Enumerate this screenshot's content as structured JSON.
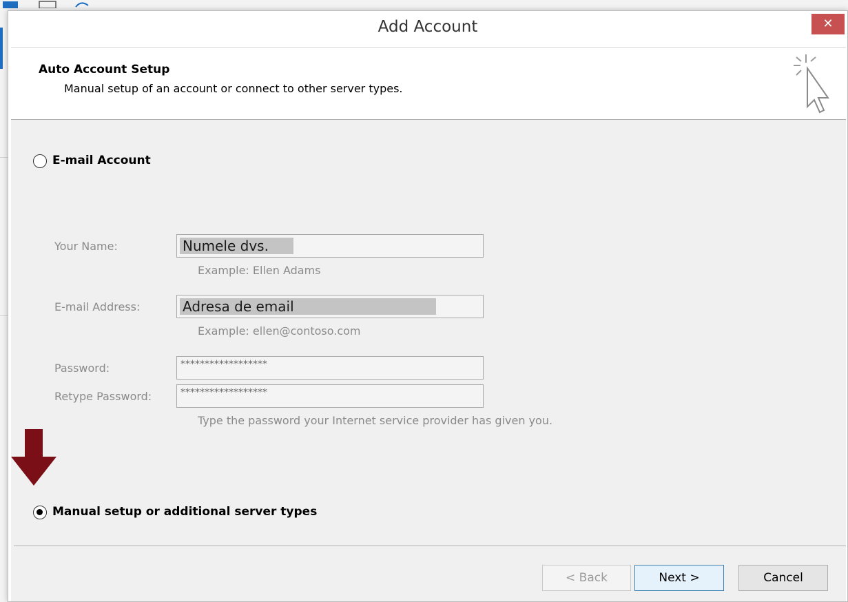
{
  "dialog": {
    "title": "Add Account",
    "close_label": "✕"
  },
  "header": {
    "title": "Auto Account Setup",
    "subtitle": "Manual setup of an account or connect to other server types."
  },
  "options": {
    "email_account": {
      "label": "E-mail Account",
      "selected": false
    },
    "manual_setup": {
      "label": "Manual setup or additional server types",
      "selected": true
    }
  },
  "form": {
    "name": {
      "label": "Your Name:",
      "value": "Numele dvs.",
      "example": "Example: Ellen Adams"
    },
    "email": {
      "label": "E-mail Address:",
      "value": "Adresa de email",
      "example": "Example: ellen@contoso.com"
    },
    "password": {
      "label": "Password:",
      "value": "******************"
    },
    "retype": {
      "label": "Retype Password:",
      "value": "******************"
    },
    "password_hint": "Type the password your Internet service provider has given you."
  },
  "buttons": {
    "back": "< Back",
    "next": "Next >",
    "cancel": "Cancel"
  },
  "colors": {
    "close_button": "#c75050",
    "arrow": "#7b0f17",
    "body_bg": "#f0f0f0"
  }
}
